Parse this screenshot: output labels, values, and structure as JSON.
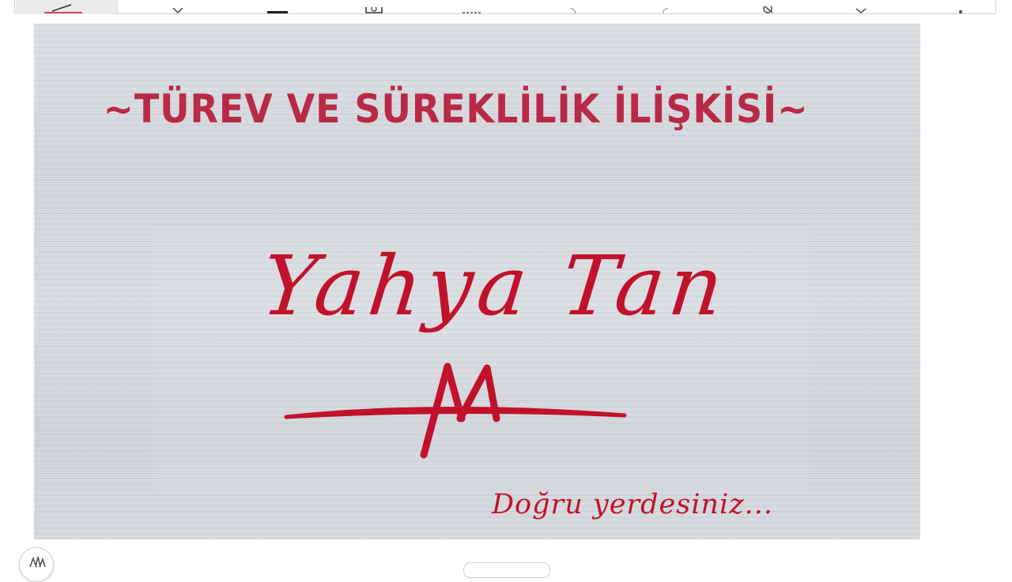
{
  "toolbar": {
    "tools": [
      {
        "name": "pen-icon",
        "active": true
      },
      {
        "name": "eraser-icon"
      },
      {
        "name": "highlighter-icon"
      },
      {
        "name": "camera-icon"
      },
      {
        "name": "lasso-icon"
      },
      {
        "name": "undo-icon"
      },
      {
        "name": "redo-icon"
      },
      {
        "name": "hide-icon"
      },
      {
        "name": "check-icon"
      },
      {
        "name": "more-icon"
      }
    ]
  },
  "slide": {
    "title": "~TÜREV VE SÜREKLİLİK İLİŞKİSİ~",
    "author": "Yahya Tan",
    "tagline": "Doğru yerdesiniz..."
  },
  "colors": {
    "title": "#b92a48",
    "accent": "#c1122c",
    "background": "#d4d8dc"
  }
}
